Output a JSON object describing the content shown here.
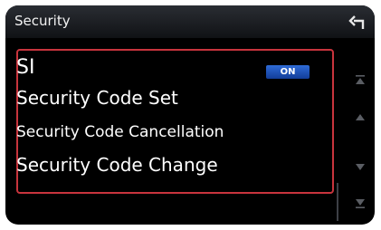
{
  "header": {
    "title": "Security",
    "back_icon": "back-arrow-icon"
  },
  "list": {
    "items": [
      {
        "label": "SI",
        "badge": "ON"
      },
      {
        "label": "Security Code Set"
      },
      {
        "label": "Security Code Cancellation"
      },
      {
        "label": "Security Code Change"
      }
    ]
  },
  "scroll": {
    "icons": [
      "scroll-to-top-icon",
      "scroll-up-icon",
      "scroll-down-icon",
      "scroll-to-bottom-icon"
    ]
  },
  "colors": {
    "highlight_border": "#c8343d",
    "badge": "#2f6bd6",
    "background": "#000000"
  }
}
